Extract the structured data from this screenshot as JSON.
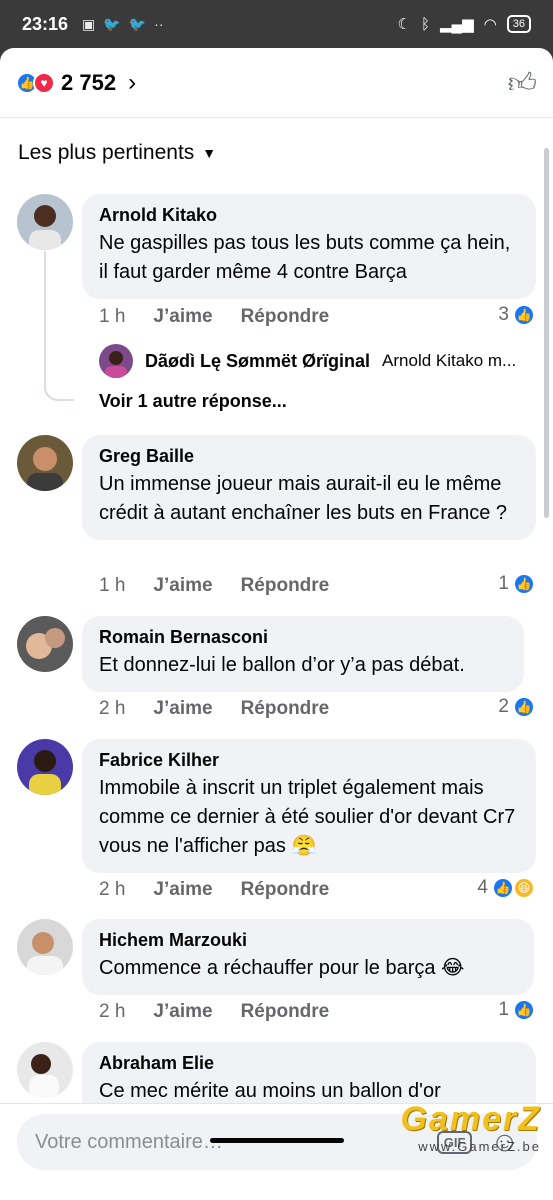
{
  "status_bar": {
    "time": "23:16",
    "battery": "36"
  },
  "header": {
    "reaction_count": "2 752"
  },
  "sort": {
    "label": "Les plus pertinents"
  },
  "comments": [
    {
      "author": "Arnold Kitako",
      "text": "Ne gaspilles pas tous les buts comme ça hein, il faut garder même 4 contre Barça",
      "time": "1 h",
      "like_label": "J’aime",
      "reply_label": "Répondre",
      "reaction_count": "3",
      "reply": {
        "author": "Dãødì Lę Sømmët Ørïginal",
        "text": "Arnold Kitako m..."
      },
      "more_replies": "Voir 1 autre réponse..."
    },
    {
      "author": "Greg Baille",
      "text": "Un immense joueur mais aurait-il eu le même crédit à autant enchaîner les buts en France ?",
      "time": "1 h",
      "like_label": "J’aime",
      "reply_label": "Répondre",
      "reaction_count": "1"
    },
    {
      "author": "Romain Bernasconi",
      "text": "Et donnez-lui le ballon d’or y’a pas débat.",
      "time": "2 h",
      "like_label": "J’aime",
      "reply_label": "Répondre",
      "reaction_count": "2"
    },
    {
      "author": "Fabrice Kilher",
      "text": "Immobile à inscrit un triplet également mais comme ce dernier à été soulier d'or devant  Cr7 vous ne l'afficher pas 😤",
      "time": "2 h",
      "like_label": "J’aime",
      "reply_label": "Répondre",
      "reaction_count": "4"
    },
    {
      "author": "Hichem Marzouki",
      "text": "Commence a réchauffer pour le barça 😂",
      "time": "2 h",
      "like_label": "J’aime",
      "reply_label": "Répondre",
      "reaction_count": "1"
    },
    {
      "author": "Abraham Elie",
      "text": "Ce mec mérite au moins un ballon d'or"
    }
  ],
  "composer": {
    "placeholder": "Votre commentaire…",
    "gif_label": "GIF"
  },
  "watermark": {
    "logo": "GamerZ",
    "url": "www.GamerZ.be"
  },
  "colors": {
    "accent": "#1877f2",
    "bubble": "#f0f2f5",
    "muted": "#65676b",
    "love": "#f0284a",
    "haha": "#f7b928"
  }
}
